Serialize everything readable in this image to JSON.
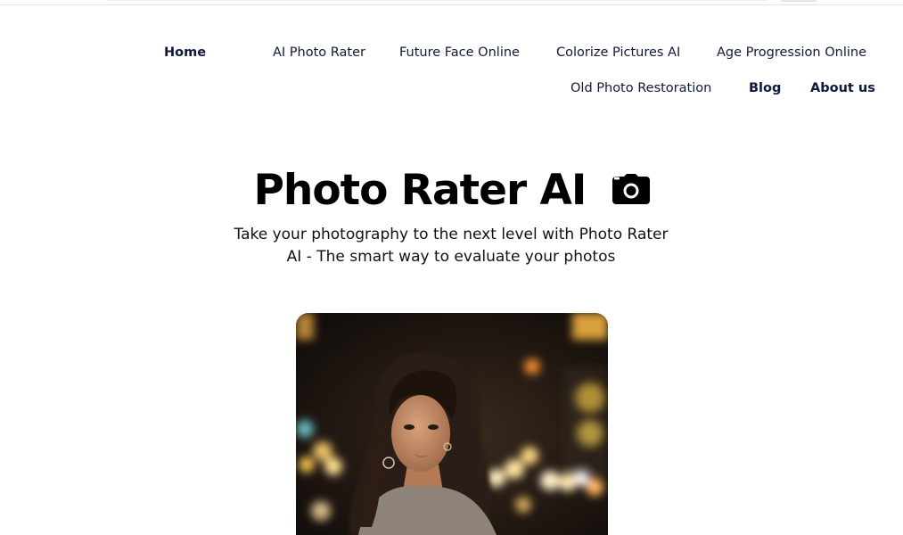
{
  "nav": {
    "home": "Home",
    "ai_photo_rater": "AI Photo Rater",
    "future_face": "Future Face Online",
    "colorize": "Colorize Pictures AI",
    "age_progression": "Age Progression Online",
    "old_photo": "Old Photo Restoration",
    "blog": "Blog",
    "about": "About us"
  },
  "hero": {
    "title": "Photo Rater AI",
    "icon": "camera-icon",
    "subtitle": "Take your photography to the next level with Photo Rater AI - The smart way to evaluate your photos"
  },
  "colors": {
    "nav_text": "#0f1a3a",
    "title": "#000000",
    "background": "#ffffff"
  }
}
